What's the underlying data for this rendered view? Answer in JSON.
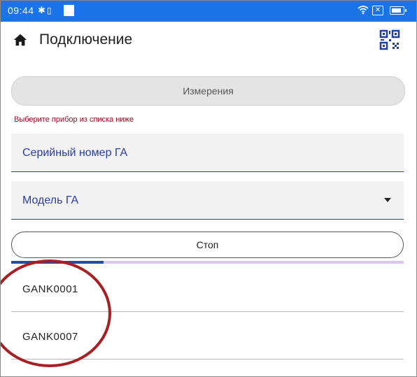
{
  "status_bar": {
    "time": "09:44",
    "bluetooth_glyph": "✱",
    "vibrate_glyph": "▯",
    "close_glyph": "✕"
  },
  "app_bar": {
    "title": "Подключение",
    "home_icon": "home-icon",
    "qr_icon": "qr-scan-icon"
  },
  "measure_button": {
    "label": "Измерения"
  },
  "hint": {
    "text": "Выберите прибор из списка ниже"
  },
  "fields": {
    "serial_label": "Серийный номер ГА",
    "model_label": "Модель ГА"
  },
  "stop_button": {
    "label": "Стоп"
  },
  "devices": [
    "GANK0001",
    "GANK0007"
  ],
  "colors": {
    "status_bar": "#1a73e8",
    "accent": "#2a3ca6",
    "error_text": "#b00020",
    "annotation": "#a81e22"
  }
}
